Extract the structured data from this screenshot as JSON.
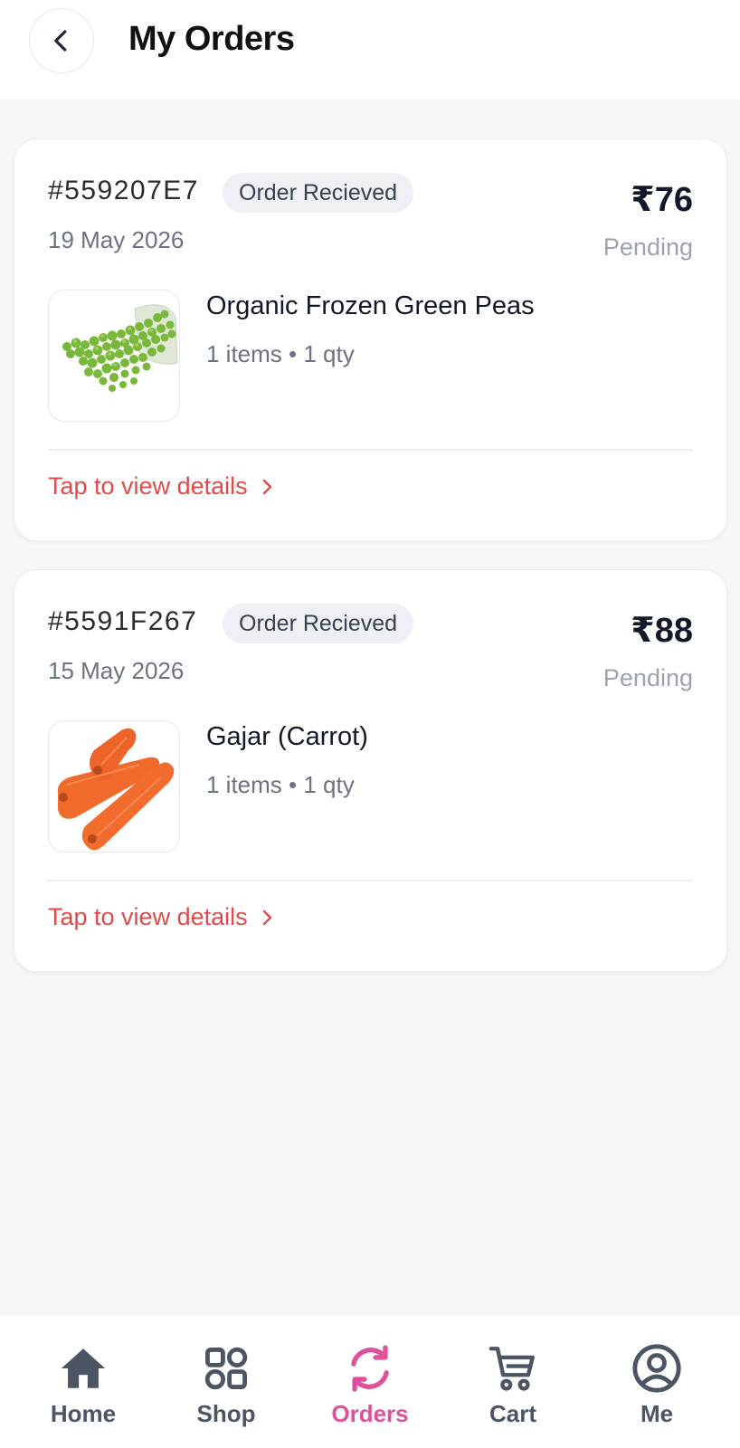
{
  "header": {
    "title": "My Orders",
    "back_icon": "chevron-left-icon"
  },
  "orders": [
    {
      "id": "#559207E7",
      "status": "Order Recieved",
      "date": "19 May 2026",
      "amount": "₹76",
      "payment_status": "Pending",
      "product_name": "Organic Frozen Green Peas",
      "product_meta": "1 items • 1 qty",
      "thumbnail": "green-peas-image",
      "details_label": "Tap to view details"
    },
    {
      "id": "#5591F267",
      "status": "Order Recieved",
      "date": "15 May 2026",
      "amount": "₹88",
      "payment_status": "Pending",
      "product_name": "Gajar (Carrot)",
      "product_meta": "1 items • 1 qty",
      "thumbnail": "carrot-image",
      "details_label": "Tap to view details"
    }
  ],
  "bottom_nav": {
    "active": "Orders",
    "items": [
      {
        "label": "Home",
        "icon": "home-icon"
      },
      {
        "label": "Shop",
        "icon": "grid-icon"
      },
      {
        "label": "Orders",
        "icon": "refresh-icon"
      },
      {
        "label": "Cart",
        "icon": "cart-icon"
      },
      {
        "label": "Me",
        "icon": "profile-icon"
      }
    ]
  },
  "colors": {
    "accent_red": "#e04a4a",
    "accent_pink": "#e0509a",
    "background": "#f5f6f8",
    "card": "#ffffff"
  }
}
